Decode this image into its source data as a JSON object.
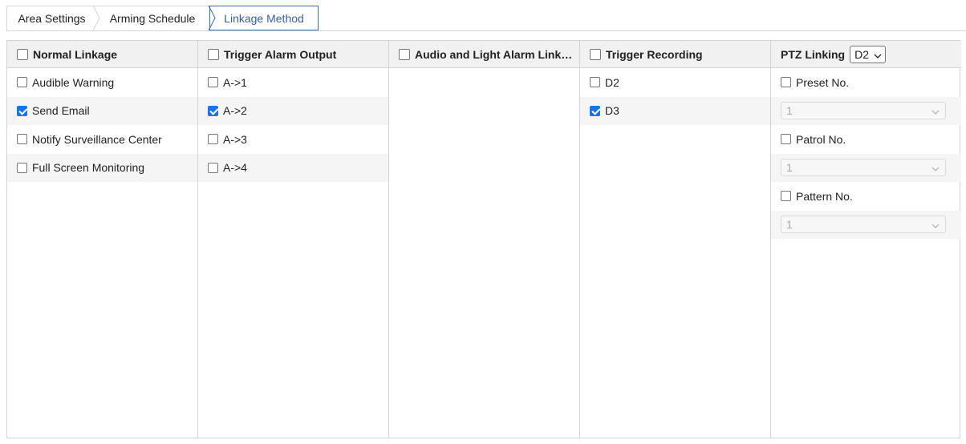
{
  "tabs": [
    {
      "label": "Area Settings"
    },
    {
      "label": "Arming Schedule"
    },
    {
      "label": "Linkage Method",
      "active": true
    }
  ],
  "colors": {
    "accent": "#3a6ea5",
    "checkbox_checked": "#1a73e8",
    "header_bg": "#f1f1f1"
  },
  "columns": {
    "normal": {
      "header": "Normal Linkage",
      "header_checked": false,
      "items": [
        {
          "label": "Audible Warning",
          "checked": false
        },
        {
          "label": "Send Email",
          "checked": true
        },
        {
          "label": "Notify Surveillance Center",
          "checked": false
        },
        {
          "label": "Full Screen Monitoring",
          "checked": false
        }
      ]
    },
    "alarm_output": {
      "header": "Trigger Alarm Output",
      "header_checked": false,
      "items": [
        {
          "label": "A->1",
          "checked": false
        },
        {
          "label": "A->2",
          "checked": true
        },
        {
          "label": "A->3",
          "checked": false
        },
        {
          "label": "A->4",
          "checked": false
        }
      ]
    },
    "audio_light": {
      "header": "Audio and Light Alarm Link…",
      "header_checked": false
    },
    "recording": {
      "header": "Trigger Recording",
      "header_checked": false,
      "items": [
        {
          "label": "D2",
          "checked": false
        },
        {
          "label": "D3",
          "checked": true
        }
      ]
    },
    "ptz": {
      "header": "PTZ Linking",
      "channel_select": "D2",
      "preset": {
        "label": "Preset No.",
        "checked": false,
        "value": "1"
      },
      "patrol": {
        "label": "Patrol No.",
        "checked": false,
        "value": "1"
      },
      "pattern": {
        "label": "Pattern No.",
        "checked": false,
        "value": "1"
      }
    }
  }
}
